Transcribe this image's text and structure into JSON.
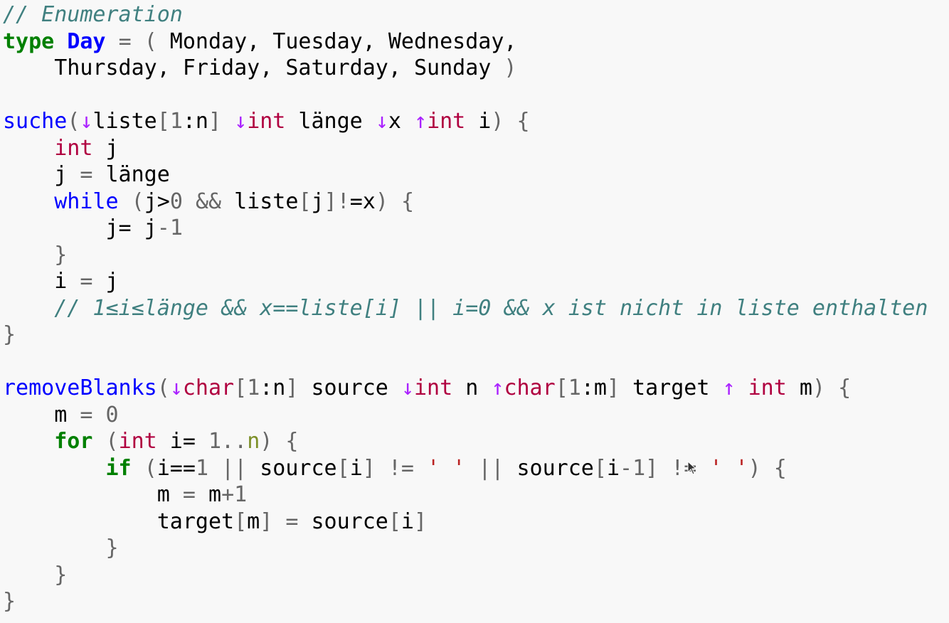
{
  "editor": {
    "language": "pseudocode",
    "lines": [
      [
        {
          "t": "c",
          "v": "// Enumeration"
        }
      ],
      [
        {
          "t": "k",
          "v": "type"
        },
        {
          "t": "n",
          "v": " "
        },
        {
          "t": "nc",
          "v": "Day"
        },
        {
          "t": "n",
          "v": " "
        },
        {
          "t": "o",
          "v": "="
        },
        {
          "t": "n",
          "v": " "
        },
        {
          "t": "p",
          "v": "("
        },
        {
          "t": "n",
          "v": " Monday, Tuesday, Wednesday,"
        }
      ],
      [
        {
          "t": "n",
          "v": "    Thursday, Friday, Saturday, Sunday "
        },
        {
          "t": "p",
          "v": ")"
        }
      ],
      [],
      [
        {
          "t": "nf",
          "v": "suche"
        },
        {
          "t": "p",
          "v": "("
        },
        {
          "t": "ar",
          "v": "↓"
        },
        {
          "t": "n",
          "v": "liste"
        },
        {
          "t": "p",
          "v": "["
        },
        {
          "t": "m",
          "v": "1"
        },
        {
          "t": "n",
          "v": ":n"
        },
        {
          "t": "p",
          "v": "]"
        },
        {
          "t": "n",
          "v": " "
        },
        {
          "t": "ar",
          "v": "↓"
        },
        {
          "t": "kt",
          "v": "int"
        },
        {
          "t": "n",
          "v": " länge "
        },
        {
          "t": "ar",
          "v": "↓"
        },
        {
          "t": "n",
          "v": "x "
        },
        {
          "t": "ar",
          "v": "↑"
        },
        {
          "t": "kt",
          "v": "int"
        },
        {
          "t": "n",
          "v": " i"
        },
        {
          "t": "p",
          "v": ")"
        },
        {
          "t": "n",
          "v": " "
        },
        {
          "t": "p",
          "v": "{"
        }
      ],
      [
        {
          "t": "n",
          "v": "    "
        },
        {
          "t": "kt",
          "v": "int"
        },
        {
          "t": "n",
          "v": " j"
        }
      ],
      [
        {
          "t": "n",
          "v": "    j "
        },
        {
          "t": "o",
          "v": "="
        },
        {
          "t": "n",
          "v": " länge"
        }
      ],
      [
        {
          "t": "n",
          "v": "    "
        },
        {
          "t": "nw",
          "v": "while"
        },
        {
          "t": "n",
          "v": " "
        },
        {
          "t": "p",
          "v": "("
        },
        {
          "t": "n",
          "v": "j>"
        },
        {
          "t": "m",
          "v": "0"
        },
        {
          "t": "n",
          "v": " "
        },
        {
          "t": "o",
          "v": "&&"
        },
        {
          "t": "n",
          "v": " liste"
        },
        {
          "t": "p",
          "v": "["
        },
        {
          "t": "n",
          "v": "j"
        },
        {
          "t": "p",
          "v": "]!"
        },
        {
          "t": "n",
          "v": "=x"
        },
        {
          "t": "p",
          "v": ")"
        },
        {
          "t": "n",
          "v": " "
        },
        {
          "t": "p",
          "v": "{"
        }
      ],
      [
        {
          "t": "n",
          "v": "        j= j"
        },
        {
          "t": "o",
          "v": "-"
        },
        {
          "t": "m",
          "v": "1"
        }
      ],
      [
        {
          "t": "n",
          "v": "    "
        },
        {
          "t": "p",
          "v": "}"
        }
      ],
      [
        {
          "t": "n",
          "v": "    i "
        },
        {
          "t": "o",
          "v": "="
        },
        {
          "t": "n",
          "v": " j"
        }
      ],
      [
        {
          "t": "n",
          "v": "    "
        },
        {
          "t": "c",
          "v": "// 1≤i≤länge && x==liste[i] || i=0 && x ist nicht in liste enthalten"
        }
      ],
      [
        {
          "t": "p",
          "v": "}"
        }
      ],
      [],
      [
        {
          "t": "nf",
          "v": "removeBlanks"
        },
        {
          "t": "p",
          "v": "("
        },
        {
          "t": "ar",
          "v": "↓"
        },
        {
          "t": "kt",
          "v": "char"
        },
        {
          "t": "p",
          "v": "["
        },
        {
          "t": "m",
          "v": "1"
        },
        {
          "t": "n",
          "v": ":n"
        },
        {
          "t": "p",
          "v": "]"
        },
        {
          "t": "n",
          "v": " source "
        },
        {
          "t": "ar",
          "v": "↓"
        },
        {
          "t": "kt",
          "v": "int"
        },
        {
          "t": "n",
          "v": " n "
        },
        {
          "t": "ar",
          "v": "↑"
        },
        {
          "t": "kt",
          "v": "char"
        },
        {
          "t": "p",
          "v": "["
        },
        {
          "t": "m",
          "v": "1"
        },
        {
          "t": "n",
          "v": ":m"
        },
        {
          "t": "p",
          "v": "]"
        },
        {
          "t": "n",
          "v": " target "
        },
        {
          "t": "ar",
          "v": "↑"
        },
        {
          "t": "n",
          "v": " "
        },
        {
          "t": "kt",
          "v": "int"
        },
        {
          "t": "n",
          "v": " m"
        },
        {
          "t": "p",
          "v": ")"
        },
        {
          "t": "n",
          "v": " "
        },
        {
          "t": "p",
          "v": "{"
        }
      ],
      [
        {
          "t": "n",
          "v": "    m "
        },
        {
          "t": "o",
          "v": "="
        },
        {
          "t": "n",
          "v": " "
        },
        {
          "t": "m",
          "v": "0"
        }
      ],
      [
        {
          "t": "n",
          "v": "    "
        },
        {
          "t": "k",
          "v": "for"
        },
        {
          "t": "n",
          "v": " "
        },
        {
          "t": "p",
          "v": "("
        },
        {
          "t": "kt",
          "v": "int"
        },
        {
          "t": "n",
          "v": " i= "
        },
        {
          "t": "m",
          "v": "1.."
        },
        {
          "t": "na",
          "v": "n"
        },
        {
          "t": "p",
          "v": ")"
        },
        {
          "t": "n",
          "v": " "
        },
        {
          "t": "p",
          "v": "{"
        }
      ],
      [
        {
          "t": "n",
          "v": "        "
        },
        {
          "t": "k",
          "v": "if"
        },
        {
          "t": "n",
          "v": " "
        },
        {
          "t": "p",
          "v": "("
        },
        {
          "t": "n",
          "v": "i=="
        },
        {
          "t": "m",
          "v": "1"
        },
        {
          "t": "n",
          "v": " "
        },
        {
          "t": "o",
          "v": "||"
        },
        {
          "t": "n",
          "v": " source"
        },
        {
          "t": "p",
          "v": "["
        },
        {
          "t": "n",
          "v": "i"
        },
        {
          "t": "p",
          "v": "]"
        },
        {
          "t": "n",
          "v": " "
        },
        {
          "t": "o",
          "v": "!="
        },
        {
          "t": "n",
          "v": " "
        },
        {
          "t": "s",
          "v": "' '"
        },
        {
          "t": "n",
          "v": " "
        },
        {
          "t": "o",
          "v": "||"
        },
        {
          "t": "n",
          "v": " source"
        },
        {
          "t": "p",
          "v": "["
        },
        {
          "t": "n",
          "v": "i"
        },
        {
          "t": "o",
          "v": "-"
        },
        {
          "t": "m",
          "v": "1"
        },
        {
          "t": "p",
          "v": "]"
        },
        {
          "t": "n",
          "v": " "
        },
        {
          "t": "o",
          "v": "!="
        },
        {
          "t": "n",
          "v": " "
        },
        {
          "t": "s",
          "v": "' '"
        },
        {
          "t": "p",
          "v": ")"
        },
        {
          "t": "n",
          "v": " "
        },
        {
          "t": "p",
          "v": "{"
        }
      ],
      [
        {
          "t": "n",
          "v": "            m "
        },
        {
          "t": "o",
          "v": "="
        },
        {
          "t": "n",
          "v": " m"
        },
        {
          "t": "o",
          "v": "+"
        },
        {
          "t": "m",
          "v": "1"
        }
      ],
      [
        {
          "t": "n",
          "v": "            target"
        },
        {
          "t": "p",
          "v": "["
        },
        {
          "t": "n",
          "v": "m"
        },
        {
          "t": "p",
          "v": "]"
        },
        {
          "t": "n",
          "v": " "
        },
        {
          "t": "o",
          "v": "="
        },
        {
          "t": "n",
          "v": " source"
        },
        {
          "t": "p",
          "v": "["
        },
        {
          "t": "n",
          "v": "i"
        },
        {
          "t": "p",
          "v": "]"
        }
      ],
      [
        {
          "t": "n",
          "v": "        "
        },
        {
          "t": "p",
          "v": "}"
        }
      ],
      [
        {
          "t": "n",
          "v": "    "
        },
        {
          "t": "p",
          "v": "}"
        }
      ],
      [
        {
          "t": "p",
          "v": "}"
        }
      ]
    ]
  },
  "colors": {
    "background": "#f8f8f8",
    "comment": "#408080",
    "keyword": "#008000",
    "type": "#b00040",
    "function": "#0000ff",
    "operator": "#666666",
    "arrow": "#aa22ff",
    "string": "#ba2121"
  },
  "cursor": {
    "icon": "mouse-pointer-icon"
  }
}
